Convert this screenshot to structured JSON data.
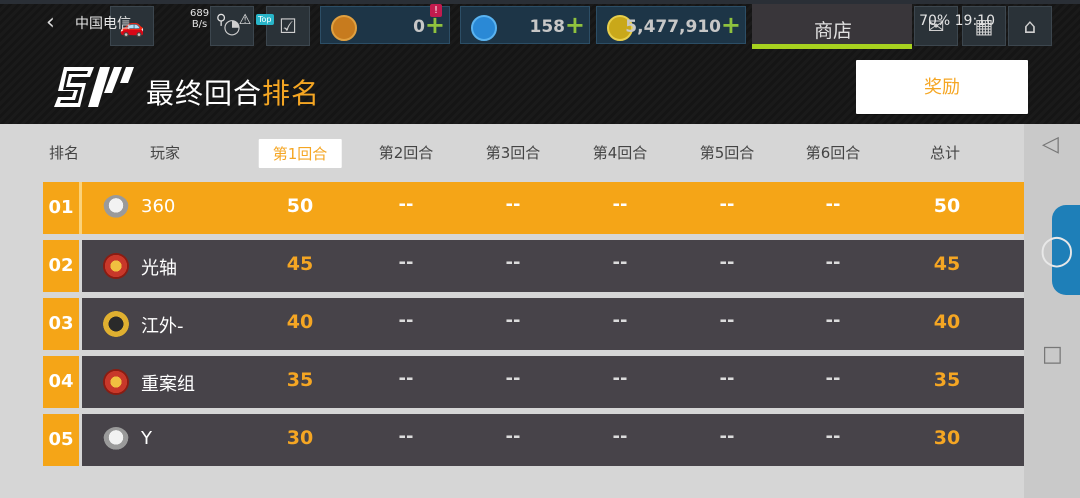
{
  "status_bar": {
    "back": "‹",
    "carrier": "中国电信",
    "net_speed_value": "689",
    "net_speed_unit": "B/s",
    "top_badge": "Top",
    "right_text": "70%  19:10",
    "signal_icons": "⚲ ⚠"
  },
  "resources": {
    "item1_value": "0",
    "item1_alert": "!",
    "item2_value": "158",
    "item3_value": "5,477,910",
    "plus": "+",
    "shop_label": "商店"
  },
  "header": {
    "title_part1": "最终回合",
    "title_part2": "排名",
    "reward_button": "奖励"
  },
  "columns": {
    "rank": "排名",
    "player": "玩家",
    "rounds": [
      "第1回合",
      "第2回合",
      "第3回合",
      "第4回合",
      "第5回合",
      "第6回合"
    ],
    "total": "总计"
  },
  "rows": [
    {
      "rank": "01",
      "name": "360",
      "scores": [
        "50",
        "--",
        "--",
        "--",
        "--",
        "--"
      ],
      "total": "50"
    },
    {
      "rank": "02",
      "name": "光轴",
      "scores": [
        "45",
        "--",
        "--",
        "--",
        "--",
        "--"
      ],
      "total": "45"
    },
    {
      "rank": "03",
      "name": "江外-",
      "scores": [
        "40",
        "--",
        "--",
        "--",
        "--",
        "--"
      ],
      "total": "40"
    },
    {
      "rank": "04",
      "name": "重案组",
      "scores": [
        "35",
        "--",
        "--",
        "--",
        "--",
        "--"
      ],
      "total": "35"
    },
    {
      "rank": "05",
      "name": "Y",
      "scores": [
        "30",
        "--",
        "--",
        "--",
        "--",
        "--"
      ],
      "total": "30"
    }
  ],
  "colors": {
    "accent": "#f5a623",
    "row_dark": "#474349",
    "highlight_row": "#f5a517"
  }
}
